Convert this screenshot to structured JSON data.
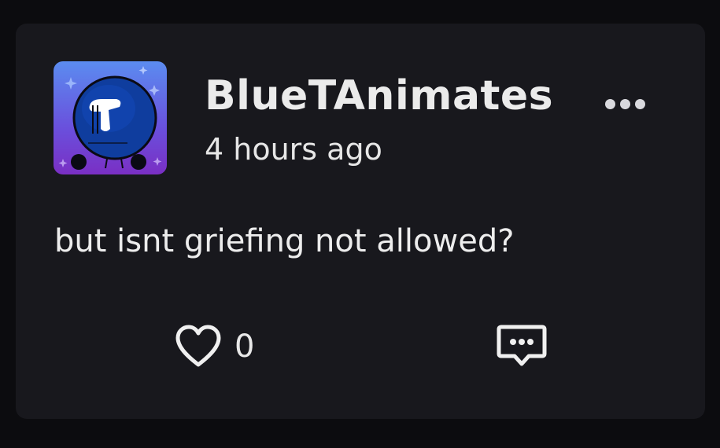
{
  "comment": {
    "username": "BlueTAnimates",
    "timestamp": "4 hours ago",
    "text": "but isnt griefing not allowed?",
    "like_count": "0"
  },
  "icons": {
    "more": "more-horizontal-icon",
    "like": "heart-icon",
    "reply": "comment-bubble-icon",
    "avatar": "avatar-image"
  },
  "colors": {
    "background": "#0c0c0f",
    "card": "#18181d",
    "text": "#ebebeb",
    "avatar_gradient_top": "#5b8cf0",
    "avatar_gradient_bottom": "#7a2fc4"
  }
}
